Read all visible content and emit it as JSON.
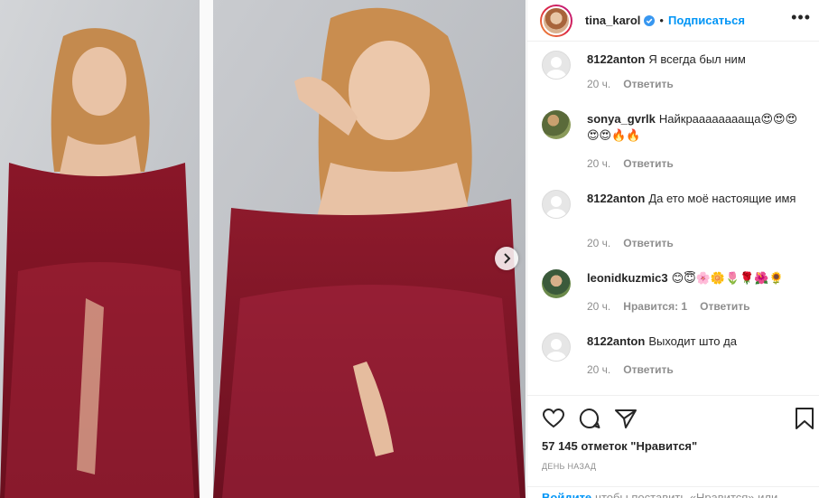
{
  "header": {
    "username": "tina_karol",
    "separator": "•",
    "follow_label": "Подписаться",
    "more": "•••"
  },
  "comments": [
    {
      "user": "8122anton",
      "text": "Я всегда был ним",
      "time": "20 ч.",
      "likes": "",
      "reply": "Ответить",
      "avatar": "blank-avatar"
    },
    {
      "user": "sonya_gvrlk",
      "text": "Найкрааааааааща😍😍😍😍😍🔥🔥",
      "time": "20 ч.",
      "likes": "",
      "reply": "Ответить",
      "avatar": "photo-avatar"
    },
    {
      "user": "8122anton",
      "text": "Да ето моё настоящие имя",
      "time": "20 ч.",
      "likes": "",
      "reply": "Ответить",
      "avatar": "blank-avatar"
    },
    {
      "user": "leonidkuzmic3",
      "text": "😊😇🌸🌼🌷🌹🌺🌻",
      "time": "20 ч.",
      "likes": "Нравится: 1",
      "reply": "Ответить",
      "avatar": "photo-avatar"
    },
    {
      "user": "8122anton",
      "text": "Выходит што да",
      "time": "20 ч.",
      "likes": "",
      "reply": "Ответить",
      "avatar": "blank-avatar"
    }
  ],
  "post": {
    "likes_text": "57 145 отметок \"Нравится\"",
    "time_ago": "ДЕНЬ НАЗАД"
  },
  "login_bar": {
    "login_label": "Войдите",
    "rest": "чтобы поставить «Нравится» или"
  },
  "colors": {
    "accent": "#0095f6",
    "dress": "#8e1a2c",
    "background": "#c9cbcf"
  }
}
